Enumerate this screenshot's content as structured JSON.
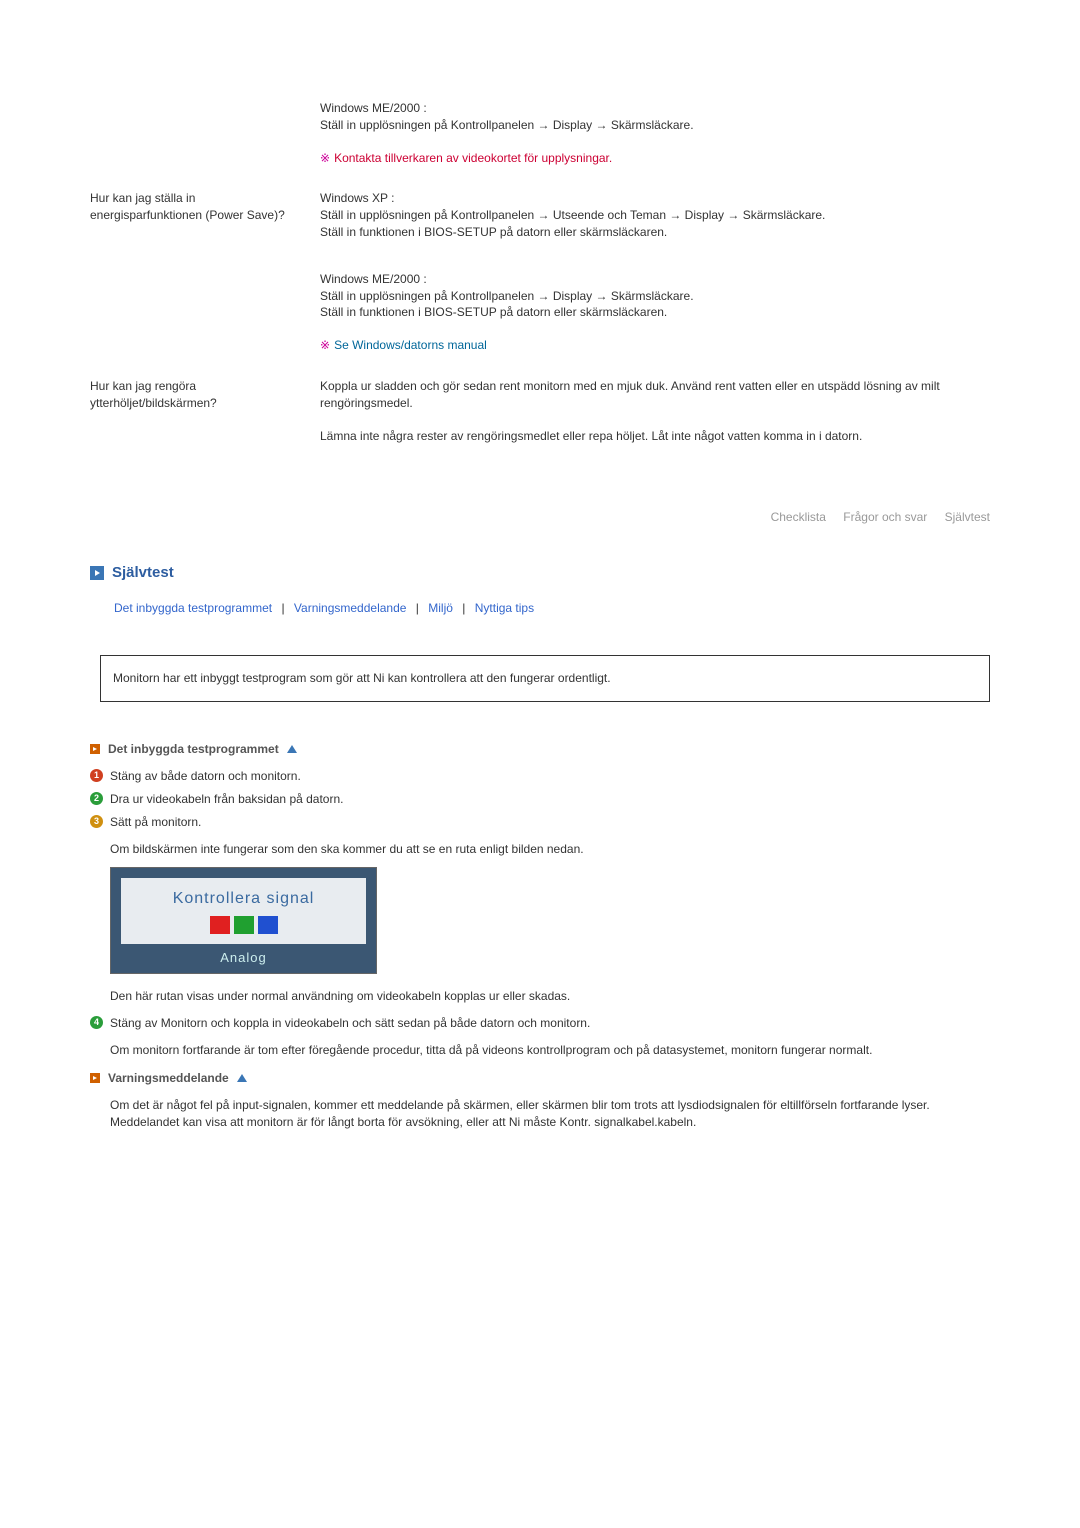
{
  "qa": {
    "row0": {
      "ans_a": "Windows ME/2000 :\nStäll in upplösningen på Kontrollpanelen → Display → Skärmsläckare.",
      "note": "Kontakta tillverkaren av videokortet för upplysningar."
    },
    "row1": {
      "q": "Hur kan jag ställa in energisparfunktionen (Power Save)?",
      "ans_a": "Windows XP :\nStäll in upplösningen på Kontrollpanelen → Utseende och Teman → Display → Skärmsläckare.\nStäll in funktionen i BIOS-SETUP på datorn eller skärmsläckaren.",
      "ans_b": "Windows ME/2000 :\nStäll in upplösningen på Kontrollpanelen → Display → Skärmsläckare.\nStäll in funktionen i BIOS-SETUP på datorn eller skärmsläckaren.",
      "note": "Se Windows/datorns manual"
    },
    "row2": {
      "q": "Hur kan jag rengöra ytterhöljet/bildskärmen?",
      "ans_a": "Koppla ur sladden och gör sedan rent monitorn med en mjuk duk. Använd rent vatten eller en utspädd lösning av milt rengöringsmedel.",
      "ans_b": "Lämna inte några rester av rengöringsmedlet eller repa höljet. Låt inte något vatten komma in i datorn."
    }
  },
  "nav": {
    "a": "Checklista",
    "b": "Frågor och svar",
    "c": "Självtest"
  },
  "section": {
    "title": "Självtest"
  },
  "sublinks": {
    "a": "Det inbyggda testprogrammet",
    "b": "Varningsmeddelande",
    "c": "Miljö",
    "d": "Nyttiga tips"
  },
  "infobox": "Monitorn har ett inbyggt testprogram som gör att Ni kan kontrollera att den fungerar ordentligt.",
  "subheadings": {
    "test": "Det inbyggda testprogrammet",
    "warn": "Varningsmeddelande"
  },
  "steps": {
    "s1": "Stäng av både datorn och monitorn.",
    "s2": "Dra ur videokabeln från baksidan på datorn.",
    "s3": "Sätt på monitorn.",
    "s3p": "Om bildskärmen inte fungerar som den ska kommer du att se en ruta enligt bilden nedan.",
    "s3after": "Den här rutan visas under normal användning om videokabeln kopplas ur eller skadas.",
    "s4": "Stäng av Monitorn och koppla in videokabeln och sätt sedan på både datorn och monitorn.",
    "s4p": "Om monitorn fortfarande är tom efter föregående procedur, titta då på videons kontrollprogram och på datasystemet, monitorn fungerar normalt."
  },
  "signal": {
    "text": "Kontrollera signal",
    "label": "Analog"
  },
  "warning_text": "Om det är något fel på input-signalen, kommer ett meddelande på skärmen, eller skärmen blir tom trots att lysdiodsignalen för eltillförseln fortfarande lyser. Meddelandet kan visa att monitorn är för långt borta för avsökning, eller att Ni måste Kontr. signalkabel.kabeln."
}
